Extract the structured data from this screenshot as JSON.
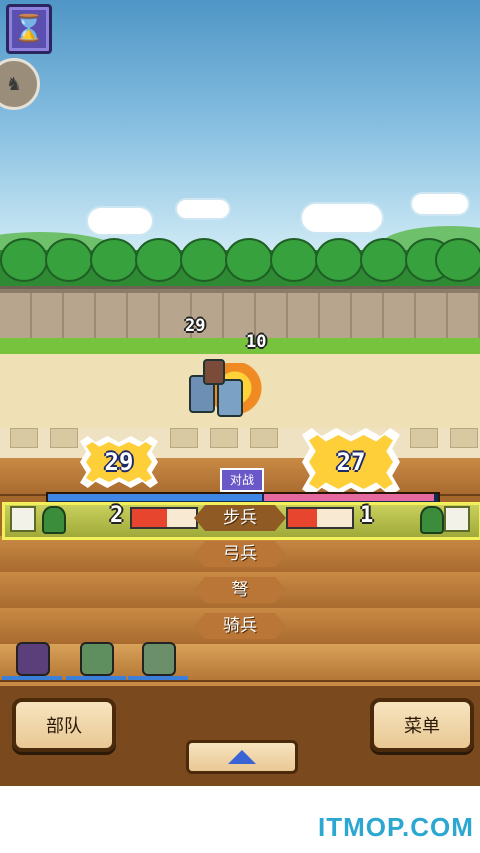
{
  "battle": {
    "damage_top_left": "29",
    "damage_top_right": "10",
    "burst_left": "29",
    "burst_right": "27",
    "duel_label": "对战",
    "hp_left_fraction": 0.55,
    "hp_right_fraction": 0.44
  },
  "lanes": [
    {
      "label": "步兵",
      "selected": true,
      "left_count": "2",
      "right_count": "1",
      "left_gauge": 0.55,
      "right_gauge": 0.45
    },
    {
      "label": "弓兵",
      "selected": false
    },
    {
      "label": "弩",
      "selected": false
    },
    {
      "label": "骑兵",
      "selected": false
    }
  ],
  "bottom_bar": {
    "left_button": "部队",
    "right_button": "菜单"
  },
  "watermark": "ITMOP.COM",
  "colors": {
    "accent_blue": "#3f86e5",
    "accent_pink": "#e66aa0",
    "wood": "#a96b2f",
    "selected_row": "#c9d05c"
  },
  "icons": {
    "top_left": "hourglass-icon",
    "avatar": "unit-portrait-icon",
    "up": "up-arrow-icon"
  }
}
